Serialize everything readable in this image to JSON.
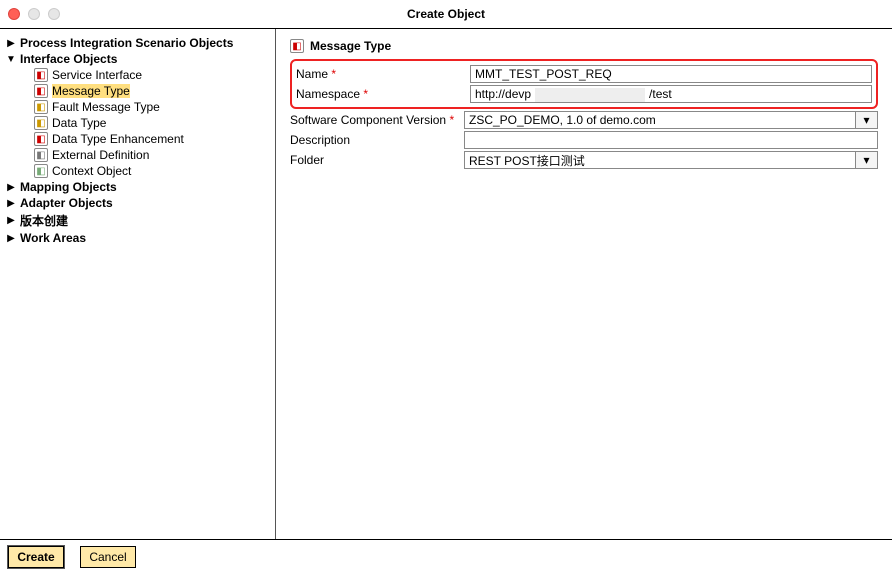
{
  "window": {
    "title": "Create Object"
  },
  "tree": {
    "top": "Process Integration Scenario Objects",
    "interface": "Interface Objects",
    "items": [
      {
        "label": "Service Interface",
        "iconClass": "ic-svc",
        "selected": false
      },
      {
        "label": "Message Type",
        "iconClass": "ic-msg",
        "selected": true
      },
      {
        "label": "Fault Message Type",
        "iconClass": "ic-flt",
        "selected": false
      },
      {
        "label": "Data Type",
        "iconClass": "ic-dt",
        "selected": false
      },
      {
        "label": "Data Type Enhancement",
        "iconClass": "ic-dte",
        "selected": false
      },
      {
        "label": "External Definition",
        "iconClass": "ic-ext",
        "selected": false
      },
      {
        "label": "Context Object",
        "iconClass": "ic-ctx",
        "selected": false
      }
    ],
    "mapping": "Mapping Objects",
    "adapter": "Adapter Objects",
    "version": "版本创建",
    "work": "Work Areas"
  },
  "form": {
    "header": "Message Type",
    "fields": {
      "name_label": "Name",
      "name_value": "MMT_TEST_POST_REQ",
      "ns_label": "Namespace",
      "ns_value_left": "http://devp",
      "ns_value_right": "/test",
      "scv_label": "Software Component Version",
      "scv_value": "ZSC_PO_DEMO, 1.0 of demo.com",
      "desc_label": "Description",
      "desc_value": "",
      "folder_label": "Folder",
      "folder_value": "REST POST接口测试"
    },
    "req_mark": "*"
  },
  "buttons": {
    "create": "Create",
    "cancel": "Cancel"
  }
}
